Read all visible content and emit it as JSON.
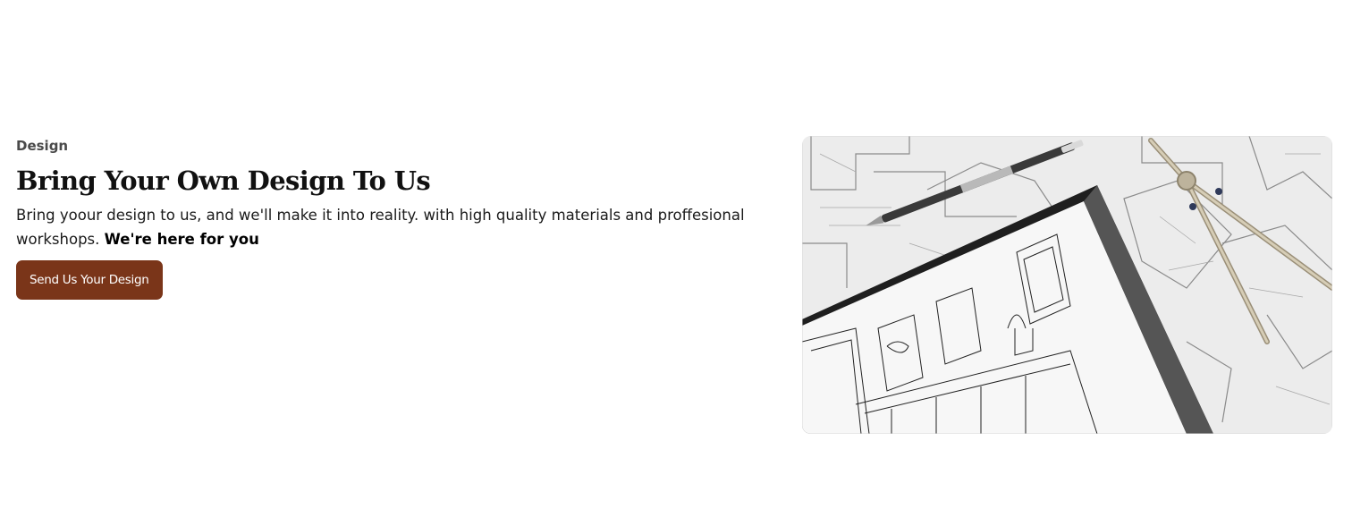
{
  "section": {
    "eyebrow": "Design",
    "title": "Bring Your Own Design To Us",
    "description": "Bring yoour design to us, and we'll make it into reality. with high quality materials and proffesional workshops.",
    "description_emphasis": "We're here for you",
    "cta_label": "Send Us Your Design"
  },
  "image": {
    "subject": "architectural-blueprints-with-tablet-sketch"
  },
  "colors": {
    "accent": "#7a3519",
    "heading": "#111111",
    "body": "#1a1a1a",
    "eyebrow": "#4a4a4a"
  }
}
